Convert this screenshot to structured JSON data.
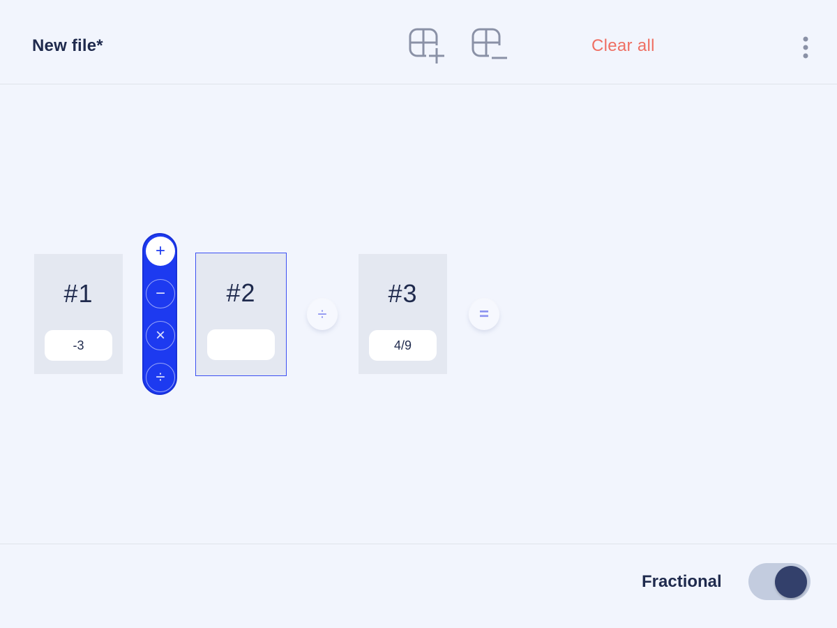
{
  "header": {
    "file_title": "New file*",
    "clear_all_label": "Clear all",
    "add_block_icon": "add-block-icon",
    "remove_block_icon": "remove-block-icon",
    "more_icon": "more-vert-icon"
  },
  "blocks": [
    {
      "label": "#1",
      "value": "-3"
    },
    {
      "label": "#2",
      "value": ""
    },
    {
      "label": "#3",
      "value": "4/9"
    }
  ],
  "operator_picker": {
    "options": [
      "+",
      "−",
      "×",
      "÷"
    ],
    "selected": "+"
  },
  "connectors": {
    "between_2_and_3": "÷",
    "equals": "="
  },
  "footer": {
    "fractional_label": "Fractional",
    "fractional_on": true
  },
  "colors": {
    "accent": "#1d3af0",
    "clear_all": "#ef6f63",
    "text_dark": "#1f2a4d",
    "background": "#f2f5fd"
  }
}
